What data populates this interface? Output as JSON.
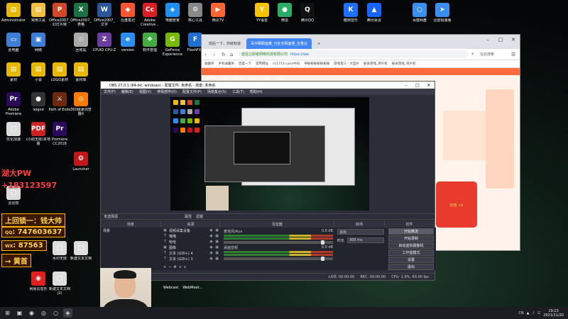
{
  "desktop_icons": [
    {
      "label": "Administrator",
      "color": "#e6b800",
      "glyph": "▤"
    },
    {
      "label": "常用工具",
      "color": "#f0c040",
      "glyph": "▤"
    },
    {
      "label": "Office2007_幻灯片转",
      "color": "#d24726",
      "glyph": "P"
    },
    {
      "label": "Office2007_表格",
      "color": "#1e7145",
      "glyph": "X"
    },
    {
      "label": "Office2007_文字",
      "color": "#2b579a",
      "glyph": "W"
    },
    {
      "label": "云盘笔记",
      "color": "#ff5533",
      "glyph": "◆"
    },
    {
      "label": "Adobe Creative...",
      "color": "#da1f26",
      "glyph": "Cc"
    },
    {
      "label": "电脑管家",
      "color": "#1f8ef1",
      "glyph": "◈"
    },
    {
      "label": "核心工具",
      "color": "#888",
      "glyph": "⚙"
    },
    {
      "label": "西瓜TV",
      "color": "#ff6633",
      "glyph": "▶"
    },
    {
      "label": "YY语音",
      "color": "#f5c400",
      "glyph": "Y"
    },
    {
      "label": "微信",
      "color": "#2aae67",
      "glyph": "●"
    },
    {
      "label": "腾讯QQ",
      "color": "#111",
      "glyph": "Q"
    },
    {
      "label": "酷狗音乐",
      "color": "#1f6fff",
      "glyph": "K"
    },
    {
      "label": "腾讯会议",
      "color": "#1664ff",
      "glyph": "▲"
    },
    {
      "label": "百度网盘",
      "color": "#3a8ef0",
      "glyph": "○"
    },
    {
      "label": "迅雷极速版",
      "color": "#3a8ef0",
      "glyph": "➤"
    },
    {
      "label": "此电脑",
      "color": "#3d7ed8",
      "glyph": "▭"
    },
    {
      "label": "网络",
      "color": "#3d7ed8",
      "glyph": "▣"
    },
    {
      "label": "回收站",
      "color": "#aaa",
      "glyph": "♲"
    },
    {
      "label": "CPUID CPU-Z",
      "color": "#6a3fa0",
      "glyph": "Z"
    },
    {
      "label": "version",
      "color": "#2a8df0",
      "glyph": "e"
    },
    {
      "label": "软件管理",
      "color": "#44aa44",
      "glyph": "❖"
    },
    {
      "label": "GeForce Experience",
      "color": "#76b900",
      "glyph": "G"
    },
    {
      "label": "FlashFXP",
      "color": "#1f6fd0",
      "glyph": "F"
    },
    {
      "label": "素材",
      "color": "#e6b800",
      "glyph": "▤"
    },
    {
      "label": "小说",
      "color": "#e6b800",
      "glyph": "▤"
    },
    {
      "label": "LOGO素材",
      "color": "#e6b800",
      "glyph": "▤"
    },
    {
      "label": "素材库",
      "color": "#e6b800",
      "glyph": "▤"
    },
    {
      "label": "Adobe Premiere",
      "color": "#2a0a5a",
      "glyph": "Pr"
    },
    {
      "label": "leigod",
      "color": "#333",
      "glyph": "●"
    },
    {
      "label": "Path of Exile",
      "color": "#6b2a10",
      "glyph": "⚔"
    },
    {
      "label": "360极速浏览器X",
      "color": "#ff7a00",
      "glyph": "◎"
    },
    {
      "label": "优化加速",
      "color": "#ddd",
      "glyph": "□"
    },
    {
      "label": "(小助无限)本地版",
      "color": "#cc2222",
      "glyph": "PDF"
    },
    {
      "label": "Premiere CC2018",
      "color": "#2a0a5a",
      "glyph": "Pr"
    },
    {
      "label": "Launcher",
      "color": "#c01818",
      "glyph": "❂"
    },
    {
      "label": "云比较",
      "color": "#ddd",
      "glyph": "□"
    },
    {
      "label": "网易云音乐",
      "color": "#e02020",
      "glyph": "◉"
    },
    {
      "label": "水印无效",
      "color": "#ddd",
      "glyph": "□"
    },
    {
      "label": "新建文本文档",
      "color": "#ddd",
      "glyph": "□"
    },
    {
      "label": "新建文本文档(2)",
      "color": "#ddd",
      "glyph": "□"
    }
  ],
  "overlays": {
    "red_top": "湖大PW",
    "red_phone": "+183123597",
    "banner1": "上回锁一：钱大帅",
    "banner2_icon": "QQ",
    "banner2": ": 747603637",
    "banner3_icon": "WX",
    "banner3": ": 87563",
    "banner4": "→ 黄首"
  },
  "browser": {
    "tabs": [
      "前后一下，你就知道",
      "百中瞬瞬面量_分处无网面量_全量丛"
    ],
    "url_prefix": "途径立即者网络科技有限公司",
    "url": "https://ww",
    "search_placeholder": "在此搜索",
    "bookmarks": [
      "收藏夹",
      "手机收藏夹",
      "百度一下",
      "常用网址",
      "cl:1713.com/中日",
      "神秘秘秘秘秘秘秘",
      "游戏第三 · 大型片",
      "秘录游戏_单片机",
      "秘录游戏_单片机"
    ],
    "site_nav": [
      "首页",
      "推荐",
      "全部",
      "鬼牌",
      "捕鱼",
      "休闲"
    ],
    "red_packet_text": "红包 +1"
  },
  "obs": {
    "title": "OBS 27.0.1 (64-bit, windows) - 配置文件: 未命名 - 场景: 未命名",
    "menu": [
      "文件(F)",
      "编辑(E)",
      "视图(V)",
      "停靠部件(D)",
      "配置文件(P)",
      "场景集合(S)",
      "工具(T)",
      "帮助(H)"
    ],
    "toolbar_label": "未选择源",
    "toolbar_props": "属性",
    "toolbar_filters": "滤镜",
    "docks": [
      "场景",
      "来源",
      "混音器",
      "转场",
      "控件"
    ],
    "scenes": [
      "场景"
    ],
    "sources": [
      {
        "type": "▣",
        "name": "视频采集设备"
      },
      {
        "type": "T",
        "name": "哦哦"
      },
      {
        "type": "T",
        "name": "哈哈"
      },
      {
        "type": "▣",
        "name": "图像"
      },
      {
        "type": "T",
        "name": "文本 (GDI+) 4"
      },
      {
        "type": "T",
        "name": "文本 (GDI+) 3"
      }
    ],
    "source_flags": "◉ ▣",
    "mixer": [
      {
        "name": "麦克风/Aux",
        "db": "0.0 dB"
      },
      {
        "name": "桌面音频",
        "db": "0.0 dB"
      }
    ],
    "controls": [
      "开始推流",
      "开始录制",
      "启动虚拟摄像机",
      "工作室模式",
      "设置",
      "退出"
    ],
    "transition": {
      "label": "淡出",
      "duration_label": "时长",
      "duration": "300 ms"
    },
    "status": [
      "LIVE: 00:00:00",
      "REC: 00:00:00",
      "CPU: 1.9%, 60.00 fps"
    ]
  },
  "taskbar": {
    "apps": [
      "⊞",
      "▣",
      "◉",
      "◎",
      "○",
      "◈"
    ],
    "tray": [
      "CN",
      "▲",
      "♪",
      "☷"
    ],
    "time": "19:23",
    "date": "2021/11/20"
  },
  "extra_labels": [
    "Webcast",
    "WebMeet..."
  ],
  "colors": {
    "obs_bg": "#2b2e38",
    "browser_accent": "#4285f4",
    "red": "#ff4040"
  }
}
